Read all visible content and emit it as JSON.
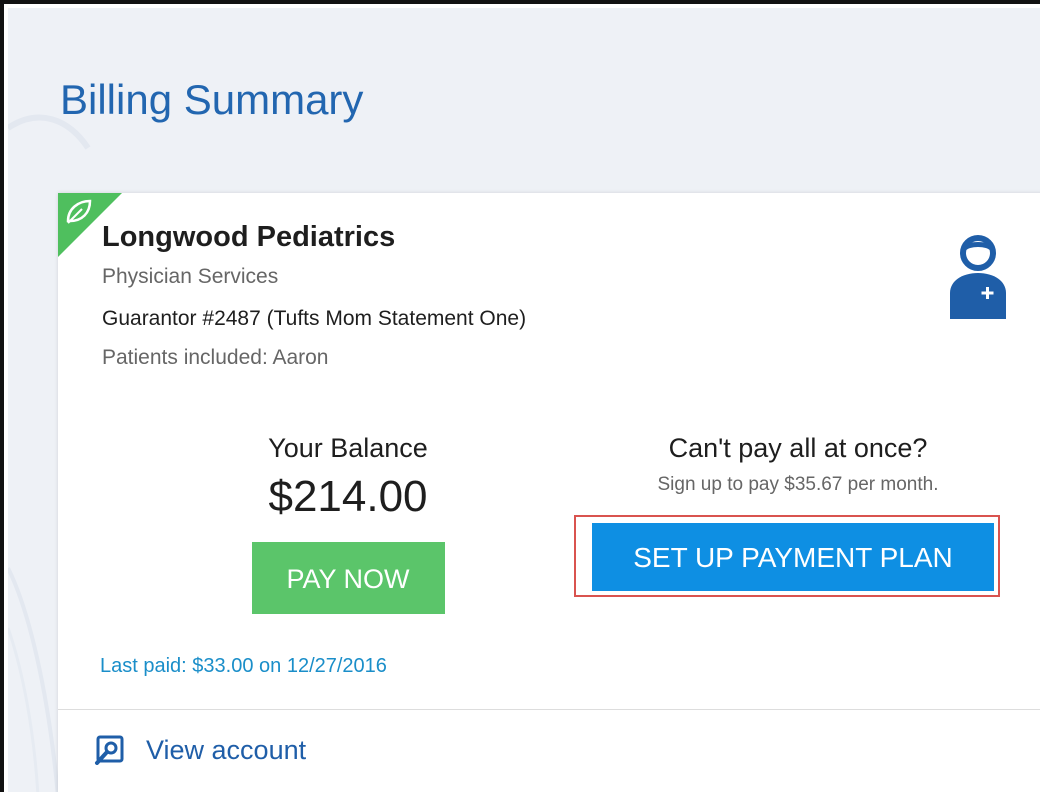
{
  "page": {
    "title": "Billing Summary"
  },
  "card": {
    "provider_name": "Longwood Pediatrics",
    "service_type": "Physician Services",
    "guarantor": "Guarantor #2487 (Tufts Mom Statement One)",
    "patients_included": "Patients included: Aaron",
    "icons": {
      "corner": "leaf-icon",
      "provider": "doctor-icon",
      "view_account": "magnifier-icon"
    }
  },
  "balance": {
    "label": "Your Balance",
    "amount": "$214.00",
    "pay_button_label": "PAY NOW",
    "last_paid": "Last paid: $33.00 on 12/27/2016"
  },
  "payment_plan": {
    "question": "Can't pay all at once?",
    "subtext": "Sign up to pay $35.67 per month.",
    "button_label": "SET UP PAYMENT PLAN"
  },
  "footer": {
    "view_account_label": "View account"
  },
  "colors": {
    "title_blue": "#2266b0",
    "pay_green": "#5bc56a",
    "plan_blue": "#0e8fe3",
    "highlight_red": "#d9534f",
    "link_blue": "#1a8ec9"
  }
}
